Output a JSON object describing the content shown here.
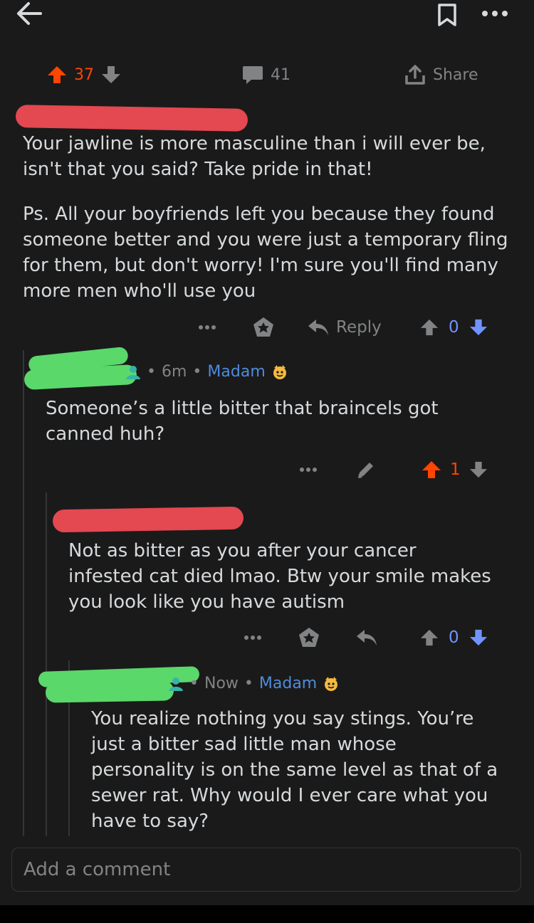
{
  "colors": {
    "upvoted": "#ff4500",
    "downvote": "#7193ff",
    "flair": "#4f8bdc",
    "muted": "#818384",
    "text": "#d7dadc"
  },
  "post": {
    "score": "37",
    "comments": "41",
    "share_label": "Share"
  },
  "comment1": {
    "paragraph1": "Your jawline is more masculine than i will ever be, isn't that you said? Take pride in that!",
    "paragraph2": "Ps. All your boyfriends left you because they found someone better and you were just a temporary fling for them, but don't worry! I'm sure you'll find many more men who'll use you",
    "reply_label": "Reply",
    "score": "0"
  },
  "comment2": {
    "time": "6m",
    "flair": "Madam",
    "text": "Someone’s a little bitter that braincels got canned huh?",
    "score": "1"
  },
  "comment3": {
    "text": "Not as bitter as you after your cancer infested cat died lmao. Btw your smile makes you look like you have autism",
    "score": "0"
  },
  "comment4": {
    "time": "Now",
    "flair": "Madam",
    "text": "You realize nothing you say stings. You’re just a bitter sad little man whose personality is on the same level as that of a sewer rat. Why would I ever care what you have to say?"
  },
  "composer": {
    "placeholder": "Add a comment"
  },
  "meta_separator": "•"
}
